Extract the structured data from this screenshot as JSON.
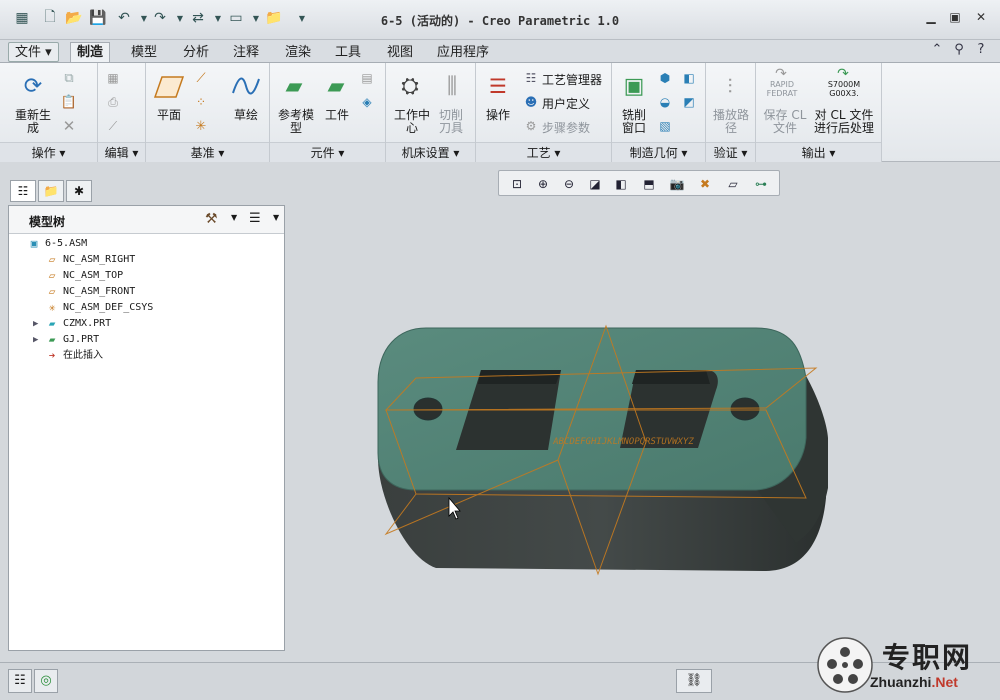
{
  "window": {
    "title": "6-5 (活动的) - Creo Parametric 1.0"
  },
  "tabs": [
    {
      "label": "文件",
      "kind": "file"
    },
    {
      "label": "制造",
      "active": true
    },
    {
      "label": "模型"
    },
    {
      "label": "分析"
    },
    {
      "label": "注释"
    },
    {
      "label": "渲染"
    },
    {
      "label": "工具"
    },
    {
      "label": "视图"
    },
    {
      "label": "应用程序"
    }
  ],
  "ribbon": {
    "groups": [
      {
        "label": "操作"
      },
      {
        "label": "编辑"
      },
      {
        "label": "基准"
      },
      {
        "label": "元件"
      },
      {
        "label": "机床设置"
      },
      {
        "label": "工艺"
      },
      {
        "label": "制造几何"
      },
      {
        "label": "验证"
      },
      {
        "label": "输出"
      }
    ],
    "buttons": {
      "regenerate": "重新生\n成",
      "plane": "平面",
      "sketch": "草绘",
      "ref_model": "参考模\n型",
      "workpiece": "工件",
      "work_center": "工作中\n心",
      "cutter": "切削\n刀具",
      "operation": "操作",
      "process_manager": "工艺管理器",
      "user_defined": "用户定义",
      "step_params": "步骤参数",
      "mill_window": "铣削\n窗口",
      "play_path": "播放路\n径",
      "save_cl": "保存 CL\n文件",
      "post_process": "对 CL 文件\n进行后处理",
      "rapid_fedrat": "RAPID\nFEDRAT",
      "s7000": "S7000M\nG00X3."
    }
  },
  "model_tree": {
    "title": "模型树",
    "items": [
      {
        "label": "6-5.ASM",
        "icon": "assembly-icon",
        "indent": 0,
        "expand": false
      },
      {
        "label": "NC_ASM_RIGHT",
        "icon": "datum-plane-icon",
        "indent": 1,
        "expand": false
      },
      {
        "label": "NC_ASM_TOP",
        "icon": "datum-plane-icon",
        "indent": 1,
        "expand": false
      },
      {
        "label": "NC_ASM_FRONT",
        "icon": "datum-plane-icon",
        "indent": 1,
        "expand": false
      },
      {
        "label": "NC_ASM_DEF_CSYS",
        "icon": "csys-icon",
        "indent": 1,
        "expand": false
      },
      {
        "label": "CZMX.PRT",
        "icon": "part-icon",
        "indent": 1,
        "expand": true
      },
      {
        "label": "GJ.PRT",
        "icon": "workpiece-icon",
        "indent": 1,
        "expand": true
      },
      {
        "label": "在此插入",
        "icon": "insert-here-icon",
        "indent": 1,
        "expand": false
      }
    ]
  },
  "viewport": {
    "model_color": "#4f7f73",
    "datum_color": "#c57a1f",
    "engraved_text": "ABCDEFGHIJKLMNOPQRSTUVWXYZ"
  },
  "watermark": {
    "cn": "专职网",
    "en_prefix": "Zhuanzhi",
    "en_suffix": ".Net"
  }
}
